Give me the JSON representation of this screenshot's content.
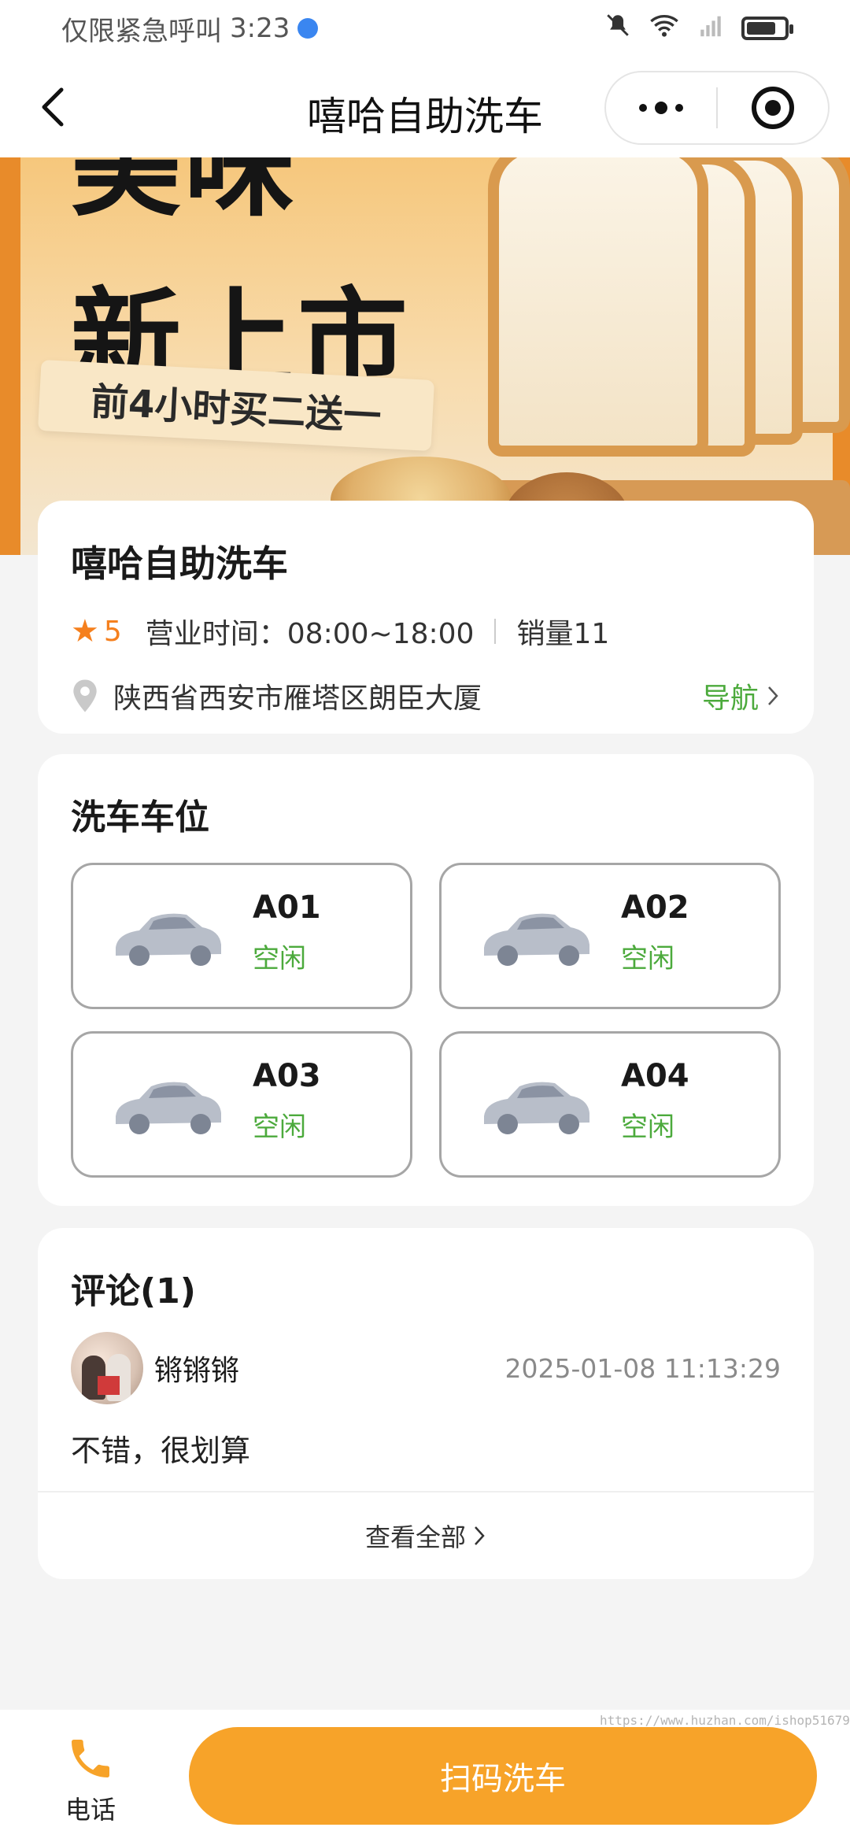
{
  "status_bar": {
    "carrier_text": "仅限紧急呼叫",
    "time": "3:23"
  },
  "nav": {
    "title": "嘻哈自助洗车"
  },
  "banner": {
    "headline_line1": "美味",
    "headline_line2": "新上市",
    "promo": "前4小时买二送一"
  },
  "store": {
    "name": "嘻哈自助洗车",
    "rating": "5",
    "hours": "营业时间：08:00~18:00",
    "sales": "销量11",
    "address": "陕西省西安市雁塔区朗臣大厦",
    "navigate_label": "导航"
  },
  "spots": {
    "title": "洗车车位",
    "items": [
      {
        "code": "A01",
        "status": "空闲"
      },
      {
        "code": "A02",
        "status": "空闲"
      },
      {
        "code": "A03",
        "status": "空闲"
      },
      {
        "code": "A04",
        "status": "空闲"
      }
    ]
  },
  "reviews": {
    "title": "评论(1)",
    "items": [
      {
        "user": "锵锵锵",
        "time": "2025-01-08 11:13:29",
        "text": "不错，很划算"
      }
    ],
    "view_all_label": "查看全部"
  },
  "bottom": {
    "phone_label": "电话",
    "scan_label": "扫码洗车"
  },
  "watermark": "https://www.huzhan.com/ishop51679",
  "colors": {
    "accent_orange": "#f7a329",
    "rating_orange": "#f5801e",
    "status_green": "#4caa3c"
  }
}
